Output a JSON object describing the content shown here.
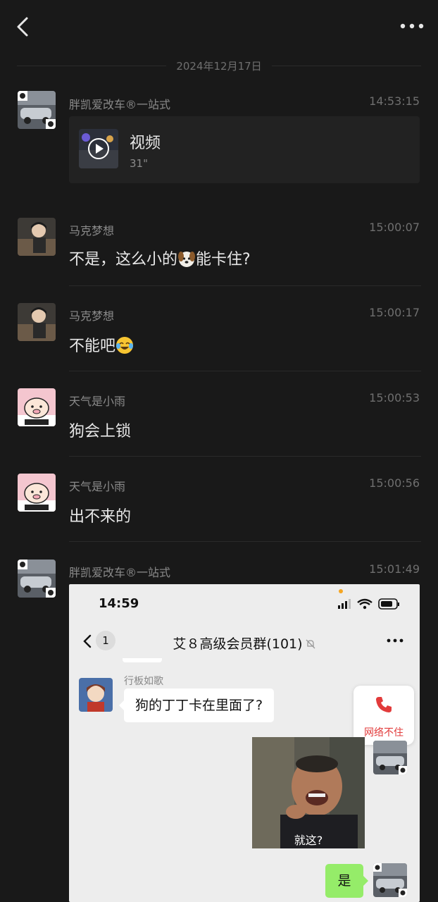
{
  "header": {
    "back_icon": "chevron-left-icon",
    "more_icon": "more-dots-icon"
  },
  "date_divider": "2024年12月17日",
  "messages": [
    {
      "name": "胖凯爱改车®一站式",
      "time": "14:53:15",
      "type": "video",
      "video_title": "视频",
      "video_duration": "31\""
    },
    {
      "name": "马克梦想",
      "time": "15:00:07",
      "text_before": "不是，这么小的",
      "emoji": "dog-face-icon",
      "text_after": "能卡住?"
    },
    {
      "name": "马克梦想",
      "time": "15:00:17",
      "text_before": "不能吧",
      "emoji": "laughing-crying-icon",
      "text_after": ""
    },
    {
      "name": "天气是小雨",
      "time": "15:00:53",
      "text": "狗会上锁"
    },
    {
      "name": "天气是小雨",
      "time": "15:00:56",
      "text": "出不来的"
    },
    {
      "name": "胖凯爱改车®一站式",
      "time": "15:01:49",
      "type": "image"
    }
  ],
  "screenshot": {
    "status_time": "14:59",
    "back_badge": "1",
    "chat_title": "艾８高级会员群(101)",
    "sender_name": "行板如歌",
    "bubble_text": "狗的丁丁卡在里面了?",
    "call_status": "网络不住",
    "meme_caption": "就这?",
    "reply_text": "是"
  },
  "colors": {
    "background": "#191919",
    "accent_green": "#95ec69",
    "call_red": "#e23b3b"
  }
}
